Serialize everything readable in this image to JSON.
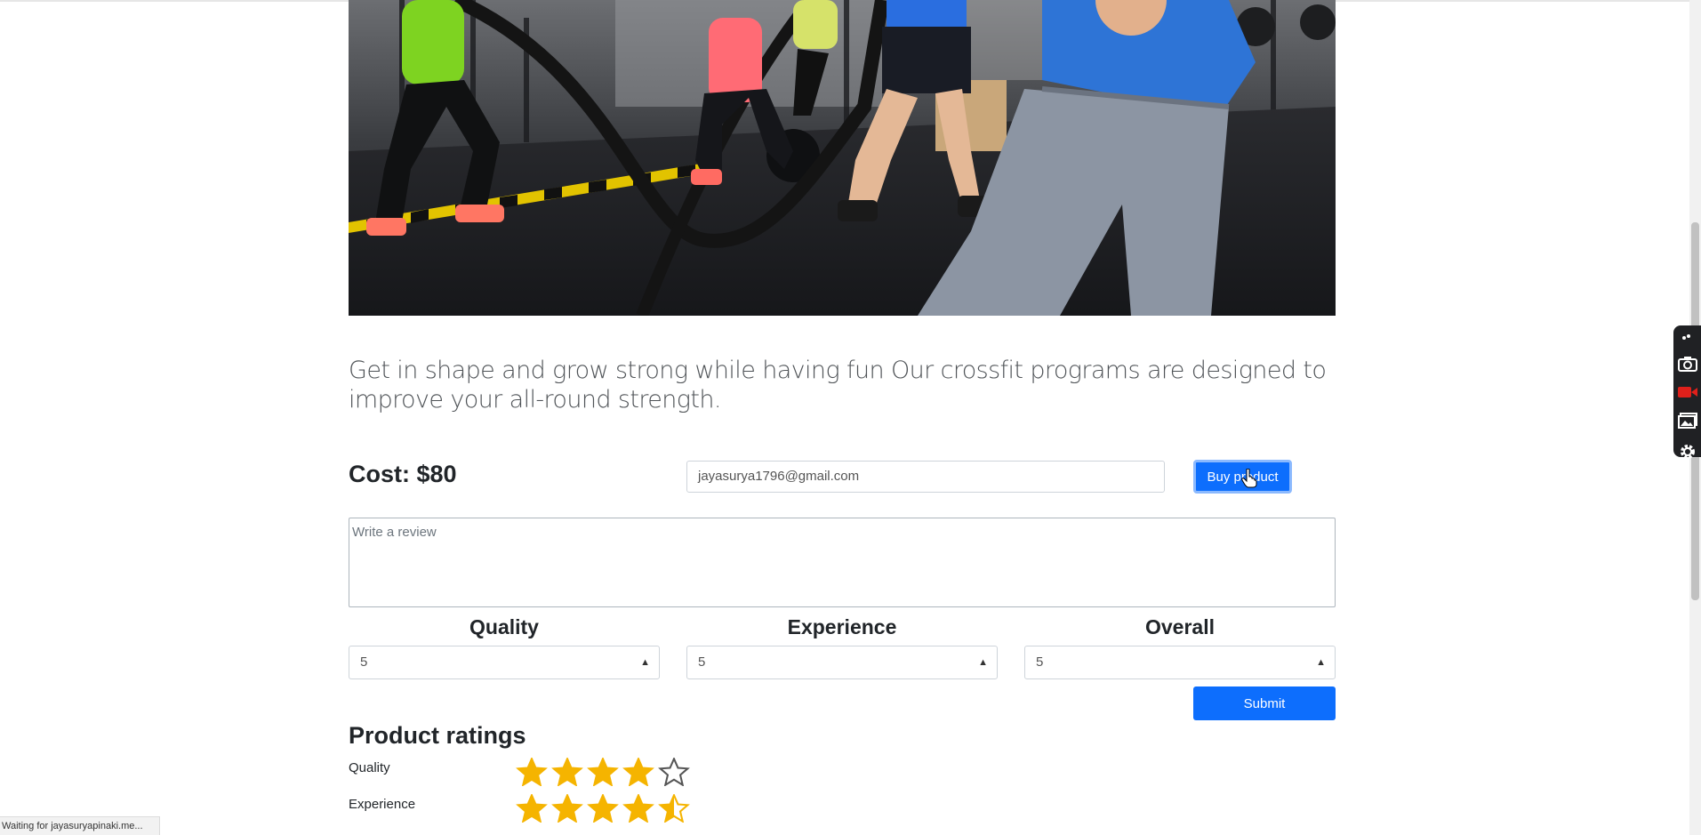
{
  "hero": {
    "alt_name": "crossfit-gym-photo"
  },
  "description": "Get in shape and grow strong while having fun Our crossfit programs are designed to improve your all-round strength.",
  "purchase": {
    "cost_label": "Cost: $80",
    "email_value": "jayasurya1796@gmail.com",
    "buy_label": "Buy product"
  },
  "review": {
    "placeholder": "Write a review"
  },
  "rating_inputs": [
    {
      "label": "Quality",
      "value": "5"
    },
    {
      "label": "Experience",
      "value": "5"
    },
    {
      "label": "Overall",
      "value": "5"
    }
  ],
  "submit_label": "Submit",
  "ratings": {
    "title": "Product ratings",
    "items": [
      {
        "label": "Quality",
        "stars": 4,
        "max": 5
      },
      {
        "label": "Experience",
        "stars": 4.5,
        "max": 5
      }
    ]
  },
  "status_text": "Waiting for jayasuryapinaki.me...",
  "colors": {
    "primary": "#0d6efd",
    "star": "#f5b400"
  },
  "side_tools": [
    "settings-dots-icon",
    "camera-icon",
    "video-record-icon",
    "gallery-icon",
    "gear-icon"
  ]
}
